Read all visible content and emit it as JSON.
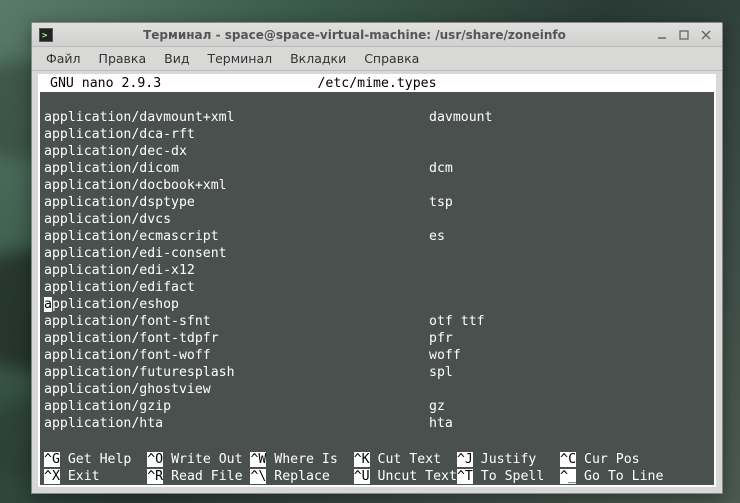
{
  "window": {
    "title": "Терминал - space@space-virtual-machine: /usr/share/zoneinfo"
  },
  "menubar": {
    "items": [
      "Файл",
      "Правка",
      "Вид",
      "Терминал",
      "Вкладки",
      "Справка"
    ]
  },
  "nano": {
    "version_label": "GNU nano 2.9.3",
    "filename": "/etc/mime.types",
    "rows": [
      {
        "mime": "",
        "ext": ""
      },
      {
        "mime": "application/davmount+xml",
        "ext": "davmount"
      },
      {
        "mime": "application/dca-rft",
        "ext": ""
      },
      {
        "mime": "application/dec-dx",
        "ext": ""
      },
      {
        "mime": "application/dicom",
        "ext": "dcm"
      },
      {
        "mime": "application/docbook+xml",
        "ext": ""
      },
      {
        "mime": "application/dsptype",
        "ext": "tsp"
      },
      {
        "mime": "application/dvcs",
        "ext": ""
      },
      {
        "mime": "application/ecmascript",
        "ext": "es"
      },
      {
        "mime": "application/edi-consent",
        "ext": ""
      },
      {
        "mime": "application/edi-x12",
        "ext": ""
      },
      {
        "mime": "application/edifact",
        "ext": ""
      },
      {
        "mime": "application/eshop",
        "ext": "",
        "cursor_at": 0
      },
      {
        "mime": "application/font-sfnt",
        "ext": "otf ttf"
      },
      {
        "mime": "application/font-tdpfr",
        "ext": "pfr"
      },
      {
        "mime": "application/font-woff",
        "ext": "woff"
      },
      {
        "mime": "application/futuresplash",
        "ext": "spl"
      },
      {
        "mime": "application/ghostview",
        "ext": ""
      },
      {
        "mime": "application/gzip",
        "ext": "gz"
      },
      {
        "mime": "application/hta",
        "ext": "hta"
      },
      {
        "mime": "",
        "ext": ""
      }
    ],
    "help": [
      {
        "key": "^G",
        "label": "Get Help"
      },
      {
        "key": "^O",
        "label": "Write Out"
      },
      {
        "key": "^W",
        "label": "Where Is"
      },
      {
        "key": "^K",
        "label": "Cut Text"
      },
      {
        "key": "^J",
        "label": "Justify"
      },
      {
        "key": "^C",
        "label": "Cur Pos"
      },
      {
        "key": "^X",
        "label": "Exit"
      },
      {
        "key": "^R",
        "label": "Read File"
      },
      {
        "key": "^\\",
        "label": "Replace"
      },
      {
        "key": "^U",
        "label": "Uncut Text"
      },
      {
        "key": "^T",
        "label": "To Spell"
      },
      {
        "key": "^_",
        "label": "Go To Line"
      }
    ]
  }
}
